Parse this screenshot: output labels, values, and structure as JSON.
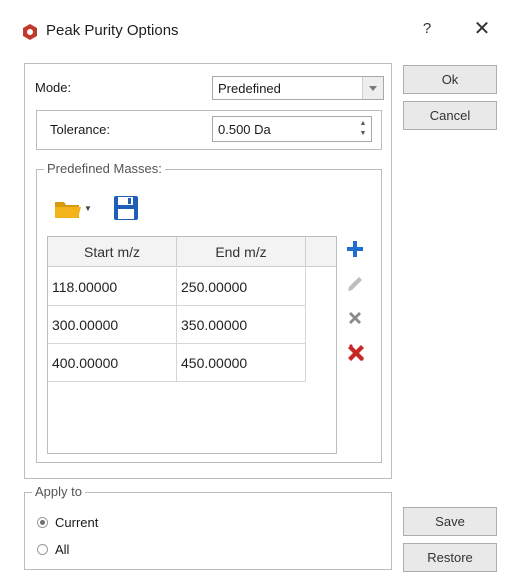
{
  "window": {
    "title": "Peak Purity Options",
    "help_label": "?",
    "close_label": "✕"
  },
  "mode": {
    "label": "Mode:",
    "value": "Predefined"
  },
  "tolerance": {
    "label": "Tolerance:",
    "value": "0.500 Da"
  },
  "predefined_masses": {
    "legend": "Predefined Masses:",
    "columns": [
      "Start m/z",
      "End m/z"
    ],
    "rows": [
      {
        "start": "118.00000",
        "end": "250.00000"
      },
      {
        "start": "300.00000",
        "end": "350.00000"
      },
      {
        "start": "400.00000",
        "end": "450.00000"
      }
    ],
    "toolbar_icons": [
      "open-folder-icon",
      "save-disk-icon"
    ],
    "side_icons": [
      "add-icon",
      "edit-icon",
      "delete-icon",
      "delete-all-icon"
    ]
  },
  "buttons": {
    "ok": "Ok",
    "cancel": "Cancel",
    "save": "Save",
    "restore": "Restore"
  },
  "apply_to": {
    "legend": "Apply to",
    "options": [
      {
        "label": "Current",
        "selected": true
      },
      {
        "label": "All",
        "selected": false
      }
    ]
  },
  "colors": {
    "accent_blue": "#1f6fd1",
    "folder_yellow": "#f2b31b",
    "delete_red": "#c62828",
    "app_icon_red": "#c0392b"
  }
}
